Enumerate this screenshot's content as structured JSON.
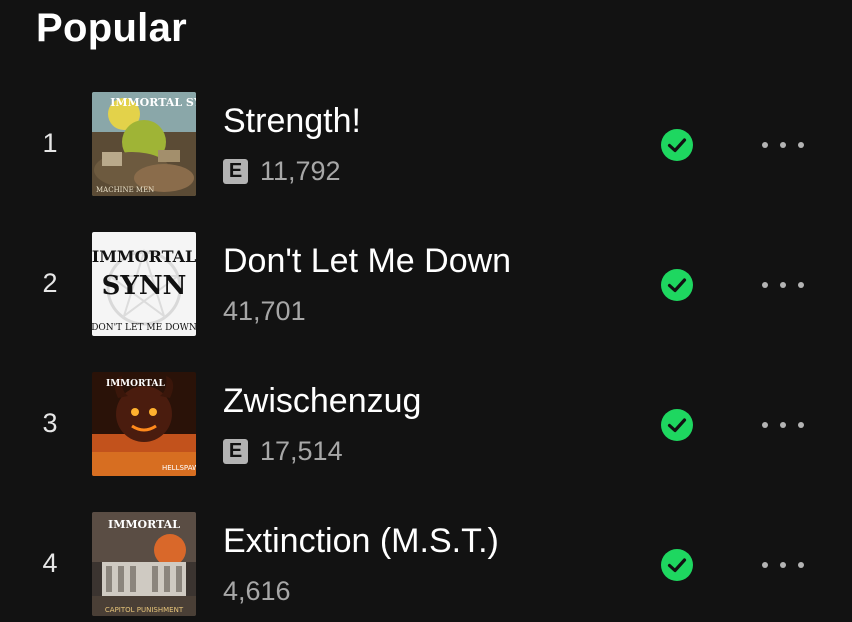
{
  "section": {
    "title": "Popular"
  },
  "colors": {
    "background": "#121212",
    "accent": "#1ed760",
    "muted": "#a7a7a7"
  },
  "tracks": [
    {
      "rank": "1",
      "title": "Strength!",
      "explicit": true,
      "explicit_label": "E",
      "plays": "11,792",
      "cover": {
        "art_text": "IMMORTAL SYNN",
        "caption": "MACHINE MEN"
      },
      "saved_icon": "check-circle-icon",
      "more_icon": "more-dots-icon"
    },
    {
      "rank": "2",
      "title": "Don't Let Me Down",
      "explicit": false,
      "explicit_label": "",
      "plays": "41,701",
      "cover": {
        "art_text": "IMMORTAL SYNN",
        "caption": "DON'T LET ME DOWN"
      },
      "saved_icon": "check-circle-icon",
      "more_icon": "more-dots-icon"
    },
    {
      "rank": "3",
      "title": "Zwischenzug",
      "explicit": true,
      "explicit_label": "E",
      "plays": "17,514",
      "cover": {
        "art_text": "IMMORTAL SYNN",
        "caption": "HELLSPAWN"
      },
      "saved_icon": "check-circle-icon",
      "more_icon": "more-dots-icon"
    },
    {
      "rank": "4",
      "title": "Extinction (M.S.T.)",
      "explicit": false,
      "explicit_label": "",
      "plays": "4,616",
      "cover": {
        "art_text": "IMMORTAL SYNN",
        "caption": "CAPITOL PUNISHMENT"
      },
      "saved_icon": "check-circle-icon",
      "more_icon": "more-dots-icon"
    }
  ]
}
